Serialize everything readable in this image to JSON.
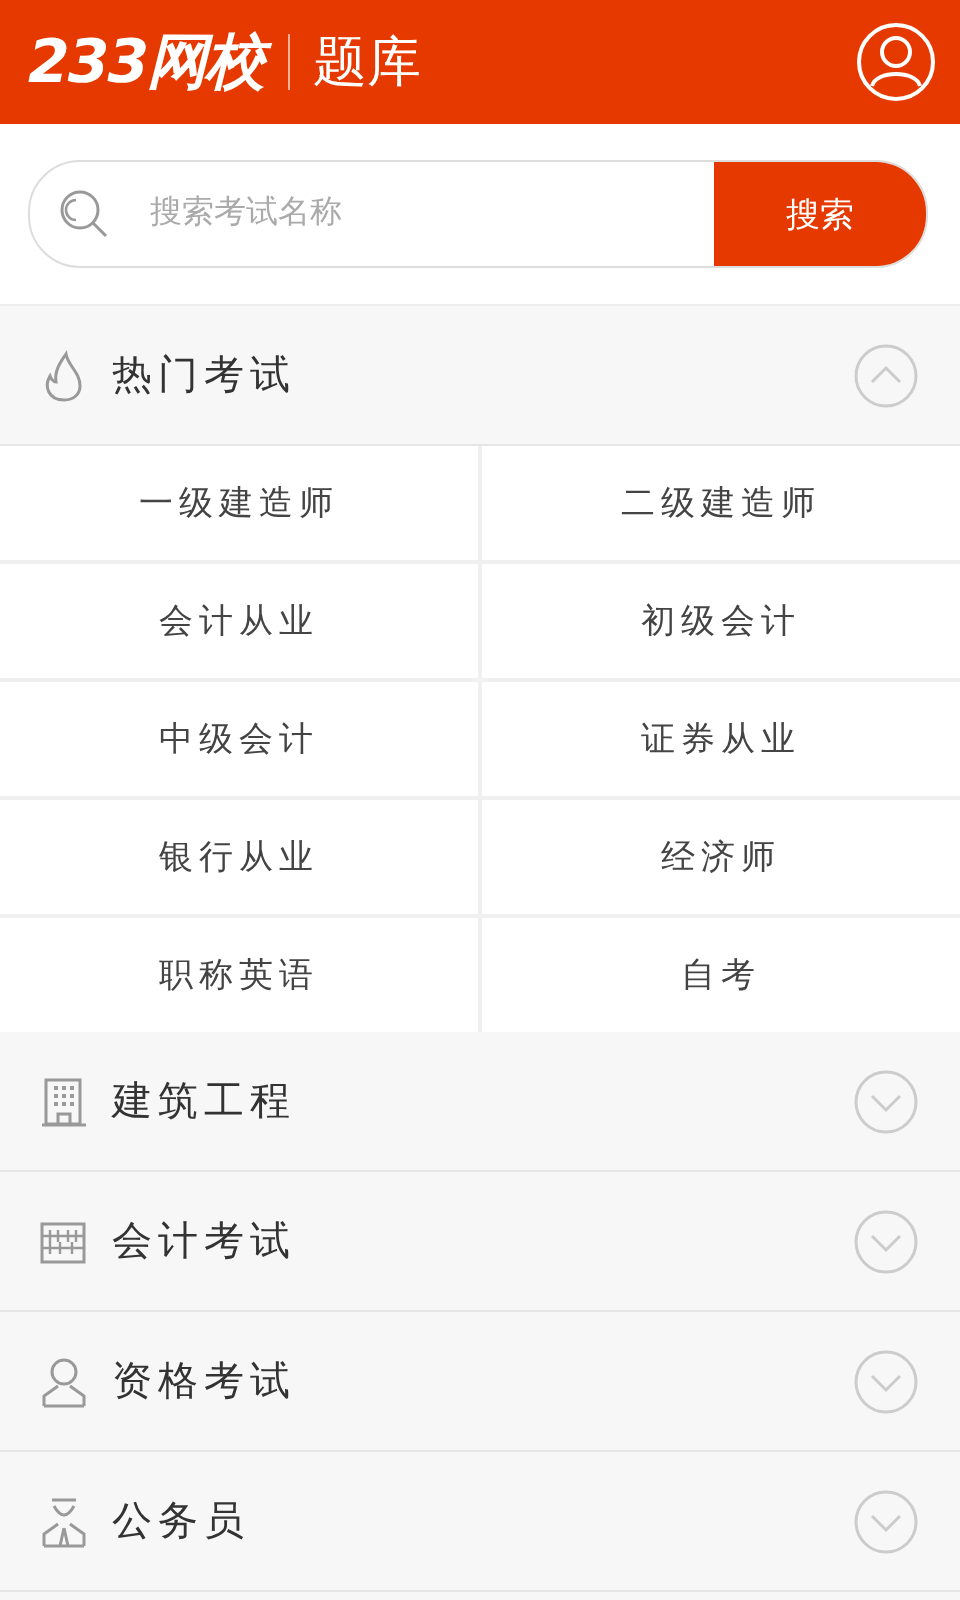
{
  "header": {
    "logo": "233网校",
    "title": "题库"
  },
  "search": {
    "placeholder": "搜索考试名称",
    "button": "搜索"
  },
  "sections": [
    {
      "kind": "hot",
      "title": "热门考试",
      "expanded": true,
      "items": [
        "一级建造师",
        "二级建造师",
        "会计从业",
        "初级会计",
        "中级会计",
        "证券从业",
        "银行从业",
        "经济师",
        "职称英语",
        "自考"
      ]
    },
    {
      "kind": "building",
      "title": "建筑工程",
      "expanded": false
    },
    {
      "kind": "abacus",
      "title": "会计考试",
      "expanded": false
    },
    {
      "kind": "person",
      "title": "资格考试",
      "expanded": false
    },
    {
      "kind": "officer",
      "title": "公务员",
      "expanded": false
    }
  ]
}
